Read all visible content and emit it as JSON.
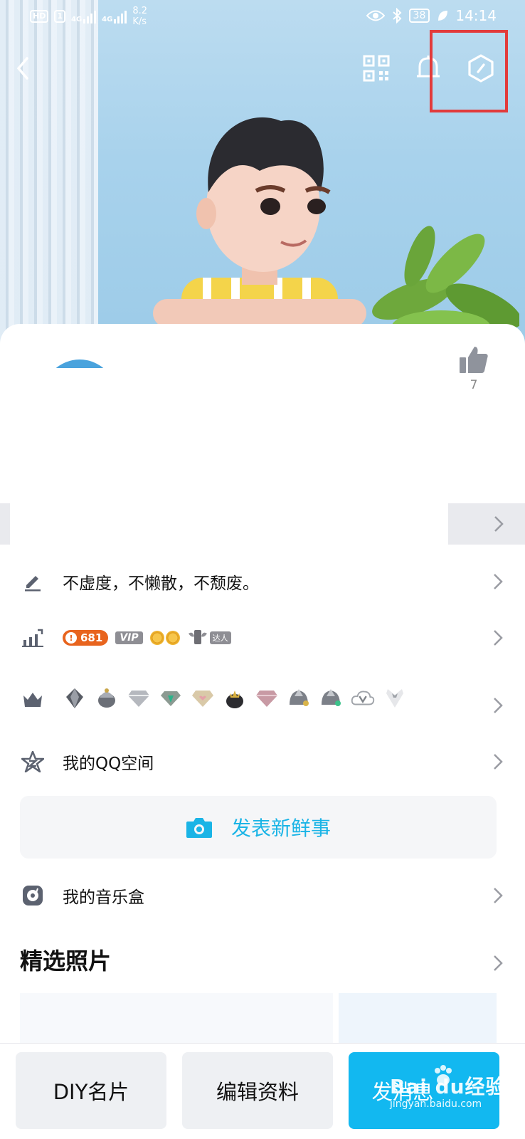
{
  "status_bar": {
    "hd": "HD",
    "sim1": "1",
    "net1": "4G",
    "net2": "4G",
    "speed_value": "8.2",
    "speed_unit": "K/s",
    "battery": "38",
    "time": "14:14"
  },
  "profile": {
    "like_count": "7"
  },
  "rows": {
    "signature": "不虚度，不懒散，不颓废。",
    "level_value": "681",
    "vip_label": "VIP",
    "daren_label": "达人",
    "qzone": "我的QQ空间",
    "music": "我的音乐盒"
  },
  "post_button": {
    "label": "发表新鲜事"
  },
  "photos": {
    "title": "精选照片"
  },
  "bottom_bar": {
    "diy": "DIY名片",
    "edit": "编辑资料",
    "send": "发消息"
  },
  "watermark": {
    "brand": "Bai du经验",
    "url": "jingyan.baidu.com"
  },
  "colors": {
    "accent_blue": "#12b8f0",
    "post_text": "#1ab4e6",
    "highlight_red": "#e23b3b",
    "level_orange": "#e8641e"
  }
}
